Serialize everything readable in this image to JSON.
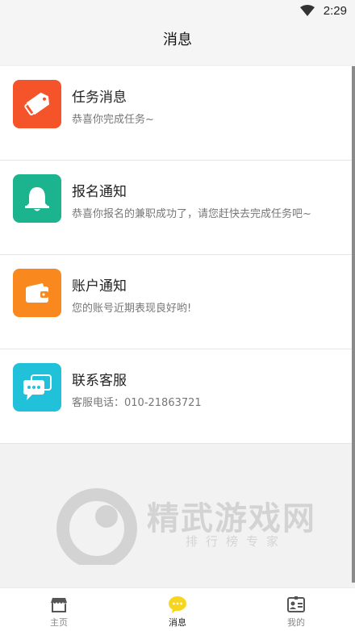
{
  "status_bar": {
    "time": "2:29"
  },
  "header": {
    "title": "消息"
  },
  "messages": [
    {
      "title": "任务消息",
      "subtitle": "恭喜你完成任务~",
      "icon": "tag-icon",
      "color": "#f5532a"
    },
    {
      "title": "报名通知",
      "subtitle": "恭喜你报名的兼职成功了，请您赶快去完成任务吧~",
      "icon": "bell-icon",
      "color": "#1cb38f"
    },
    {
      "title": "账户通知",
      "subtitle": "您的账号近期表现良好哟!",
      "icon": "wallet-icon",
      "color": "#f9891e"
    },
    {
      "title": "联系客服",
      "subtitle": "客服电话：010-21863721",
      "icon": "chat-icon",
      "color": "#20c1d9"
    }
  ],
  "watermark": {
    "name": "精武游戏网",
    "tagline": "排行榜专家"
  },
  "tabbar": {
    "items": [
      {
        "label": "主页",
        "icon": "store-icon",
        "active": false
      },
      {
        "label": "消息",
        "icon": "chat-bubble-icon",
        "active": true
      },
      {
        "label": "我的",
        "icon": "id-card-icon",
        "active": false
      }
    ],
    "active_color": "#f7d51c"
  }
}
